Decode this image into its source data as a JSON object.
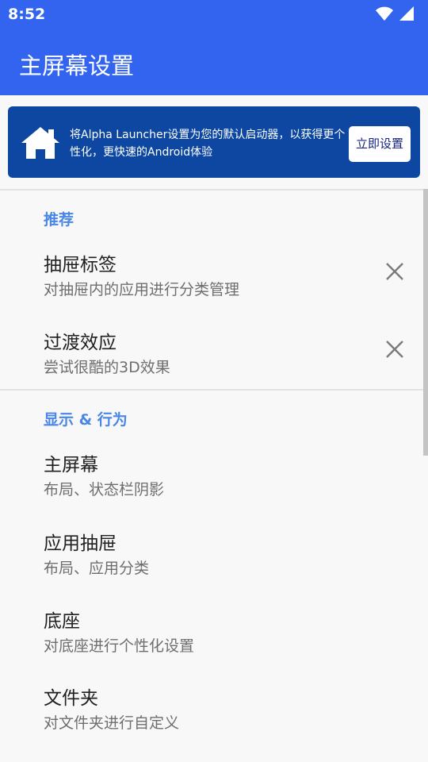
{
  "status": {
    "time": "8:52",
    "wifi_icon": "wifi-icon",
    "signal_icon": "signal-icon"
  },
  "appbar": {
    "title": "主屏幕设置",
    "color": "#3264f0"
  },
  "banner": {
    "icon": "home-icon",
    "text": "将Alpha Launcher设置为您的默认启动器，以获得更个性化，更快速的Android体验",
    "button_label": "立即设置",
    "color": "#0d47a1"
  },
  "sections": {
    "recommended": {
      "title": "推荐",
      "items": [
        {
          "title": "抽屉标签",
          "subtitle": "对抽屉内的应用进行分类管理",
          "dismiss_icon": "close-icon"
        },
        {
          "title": "过渡效应",
          "subtitle": "尝试很酷的3D效果",
          "dismiss_icon": "close-icon"
        }
      ]
    },
    "display": {
      "title": "显示 & 行为",
      "items": [
        {
          "title": "主屏幕",
          "subtitle": "布局、状态栏阴影"
        },
        {
          "title": "应用抽屉",
          "subtitle": "布局、应用分类"
        },
        {
          "title": "底座",
          "subtitle": "对底座进行个性化设置"
        },
        {
          "title": "文件夹",
          "subtitle": "对文件夹进行自定义"
        }
      ]
    }
  },
  "accent_color": "#4a86e8"
}
